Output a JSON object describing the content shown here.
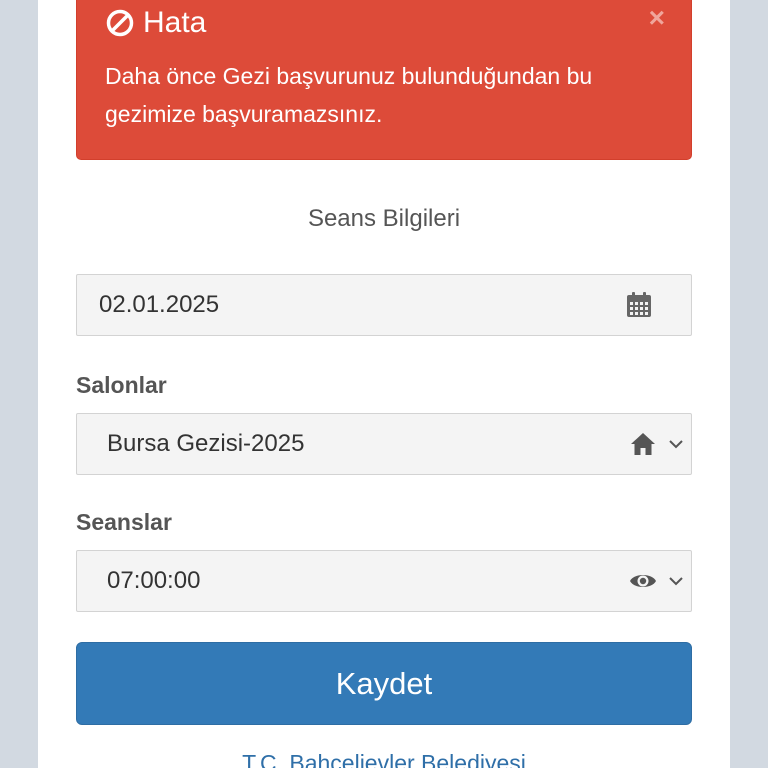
{
  "alert": {
    "title": "Hata",
    "message": "Daha önce Gezi başvurunuz bulunduğundan bu gezimize başvuramazsınız.",
    "icon": "ban-icon",
    "close_symbol": "×",
    "color": "#dd4b39"
  },
  "form": {
    "section_title": "Seans Bilgileri",
    "date": {
      "value": "02.01.2025",
      "icon": "calendar-icon"
    },
    "salon": {
      "label": "Salonlar",
      "selected": "Bursa Gezisi-2025",
      "icon": "home-icon"
    },
    "seans": {
      "label": "Seanslar",
      "selected": "07:00:00",
      "icon": "eye-icon"
    },
    "submit_label": "Kaydet",
    "submit_color": "#337ab7"
  },
  "footer": {
    "link_text": "T.C. Bahçelievler Belediyesi"
  }
}
